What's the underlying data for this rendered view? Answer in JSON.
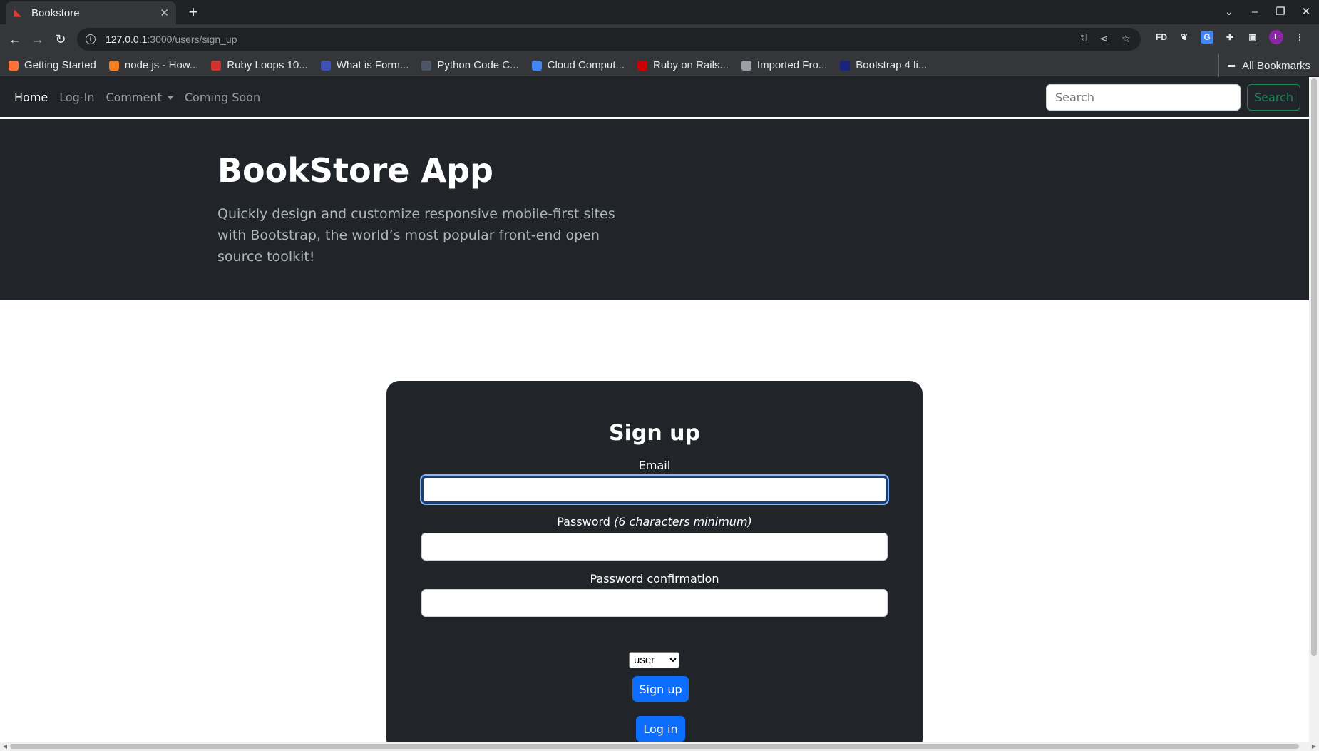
{
  "browser": {
    "tab_title": "Bookstore",
    "new_tab_label": "+",
    "url_host": "127.0.0.1",
    "url_path": ":3000/users/sign_up",
    "profile_initial": "L",
    "bookmarks": [
      {
        "label": "Getting Started",
        "icon": "firefox-icon",
        "color": "#ff7139"
      },
      {
        "label": "node.js - How...",
        "icon": "stackoverflow-icon",
        "color": "#f48024"
      },
      {
        "label": "Ruby Loops 10...",
        "icon": "ruby-icon",
        "color": "#cc342d"
      },
      {
        "label": "What is Form...",
        "icon": "shield-icon",
        "color": "#3f51b5"
      },
      {
        "label": "Python Code C...",
        "icon": "python-icon",
        "color": "#4b5563"
      },
      {
        "label": "Cloud Comput...",
        "icon": "google-cloud-icon",
        "color": "#4285f4"
      },
      {
        "label": "Ruby on Rails...",
        "icon": "rails-icon",
        "color": "#cc0000"
      },
      {
        "label": "Imported Fro...",
        "icon": "folder-icon",
        "color": "#9aa0a6"
      },
      {
        "label": "Bootstrap 4 li...",
        "icon": "bootstrap-icon",
        "color": "#1a237e"
      }
    ],
    "all_bookmarks_label": "All Bookmarks"
  },
  "navbar": {
    "links": {
      "home": "Home",
      "login": "Log-In",
      "comment": "Comment",
      "coming_soon": "Coming Soon"
    },
    "search_placeholder": "Search",
    "search_button": "Search"
  },
  "hero": {
    "title": "BookStore App",
    "lead": "Quickly design and customize responsive mobile-first sites with Bootstrap, the world’s most popular front-end open source toolkit!"
  },
  "signup": {
    "title": "Sign up",
    "email_label": "Email",
    "email_value": "",
    "password_label": "Password",
    "password_hint": "(6 characters minimum)",
    "password_confirmation_label": "Password confirmation",
    "role_selected": "user",
    "signup_button": "Sign up",
    "login_button": "Log in"
  },
  "colors": {
    "navbar_bg": "#212529",
    "primary": "#0d6efd",
    "success": "#198754"
  }
}
